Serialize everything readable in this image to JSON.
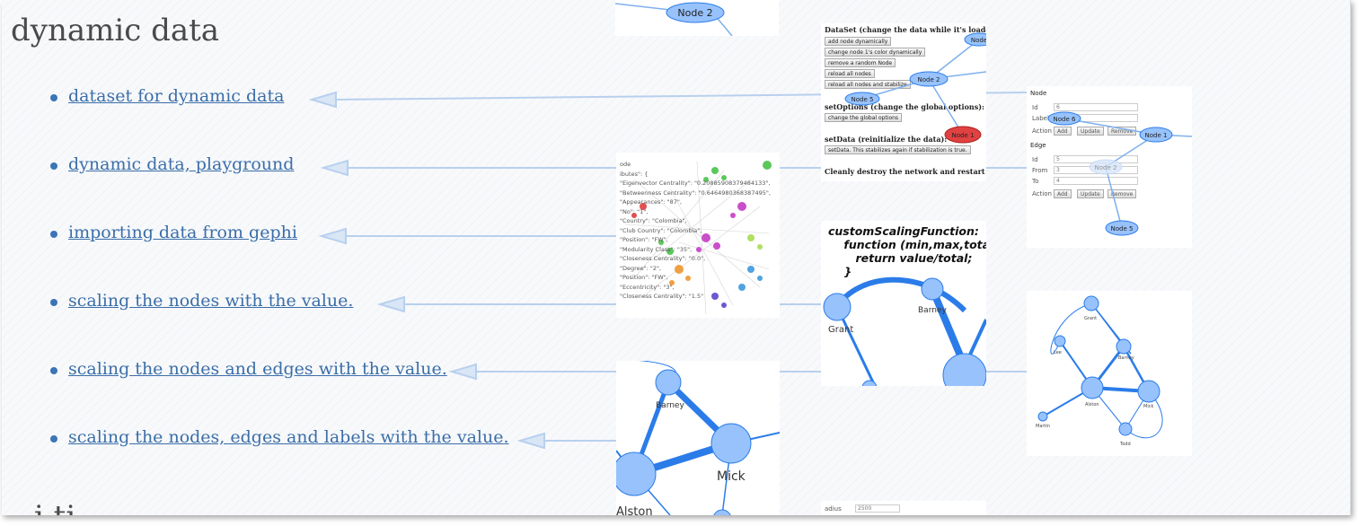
{
  "section_title": "dynamic data",
  "next_section_title_partial": "i   ti",
  "links": [
    {
      "label": "dataset for dynamic data"
    },
    {
      "label": "dynamic data, playground"
    },
    {
      "label": "importing data from gephi"
    },
    {
      "label": "scaling the nodes with the value."
    },
    {
      "label": "scaling the nodes and edges with the value."
    },
    {
      "label": "scaling the nodes, edges and labels with the value."
    }
  ],
  "thumbs": {
    "top_node": {
      "label": "Node 2"
    },
    "dataset": {
      "title1": "DataSet (change the data while it's loaded and",
      "buttons": [
        "add node dynamically",
        "change node 1's color dynamically",
        "remove a random Node",
        "reload all nodes",
        "reload all nodes and stabilize"
      ],
      "title2": "setOptions (change the global options):",
      "options_button": "change the global options",
      "title3": "setData (reinitialize the data):",
      "setdata_button": "setData. This stabilizes again if stabilization is true.",
      "title4": "Cleanly destroy the network and restart it:",
      "nodes": {
        "n1": "Node 1",
        "n2": "Node 2",
        "n5": "Node 5",
        "nb": "Node"
      }
    },
    "gephi": {
      "text_lines": [
        "ode",
        "ibutes\": {",
        "\"Eigenvector Centrality\": \"0.20885908379484133\",",
        "\"Betweenness Centrality\": \"0.6464980368387495\",",
        "\"Appearances\": \"87\",",
        "\"No\": \"1\",",
        "\"Country\": \"Colombia\",",
        "\"Club Country\": \"Colombia\",",
        "\"Position\": \"FW\",",
        "\"Modularity Class\": \"35\",",
        "\"Closeness Centrality\": \"0.0\",",
        "\"Degree\": \"2\",",
        "\"Position\": \"FW\",",
        "\"Eccentricity\": \"3\",",
        "\"Closeness Centrality\": \"1.5\""
      ]
    },
    "form": {
      "node_header": "Node",
      "id_label": "Id",
      "id_value": "6",
      "label_label": "Label",
      "label_value": "Node 6",
      "action_label": "Action",
      "add": "Add",
      "update": "Update",
      "remove": "Remove",
      "edge_header": "Edge",
      "edge_id_value": "5",
      "from_label": "From",
      "from_value": "3",
      "to_label": "To",
      "to_value": "4",
      "nodes": {
        "n1": "Node 1",
        "n2": "Node 2",
        "n5": "Node 5"
      }
    },
    "scaling": {
      "code": "customScalingFunction:\n    function (min,max,total\n       return value/total;\n    }",
      "labels": {
        "grant": "Grant",
        "barney": "Barney"
      }
    },
    "graph2": {
      "labels": {
        "grant": "Grant",
        "lee": "Lee",
        "barney": "Barney",
        "alston": "Alston",
        "mick": "Mick",
        "martin": "Martin",
        "todd": "Todd"
      }
    },
    "big_graph": {
      "labels": {
        "barney": "Barney",
        "mick": "Mick",
        "alston": "Alston"
      }
    },
    "bottom_strip": {
      "label": "adius",
      "value": "2500"
    }
  },
  "colors": {
    "link": "#3a6ea8",
    "node_fill": "#97c2fc",
    "node_stroke": "#2b7ce9",
    "edge": "#2b7ce9",
    "node_red": "#e04141"
  }
}
